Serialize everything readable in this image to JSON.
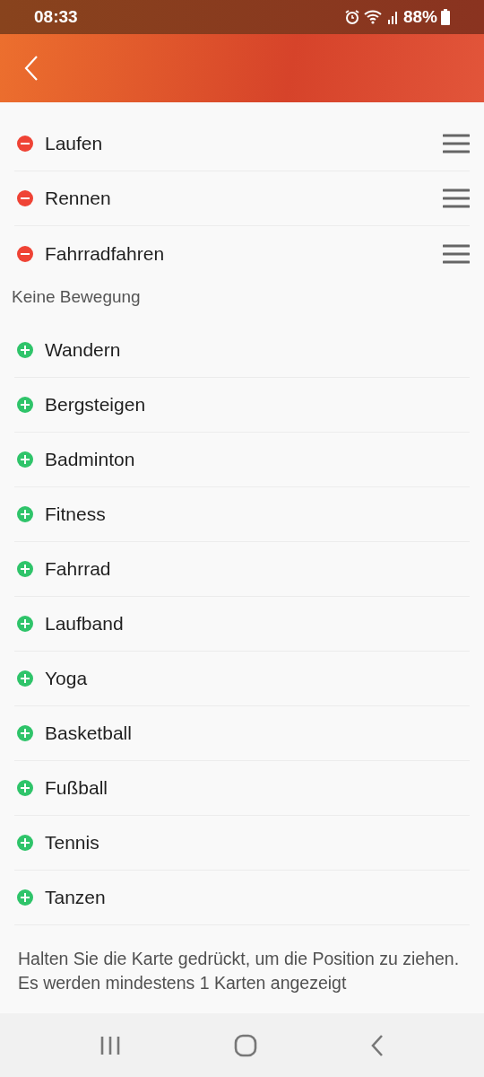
{
  "status_bar": {
    "time": "08:33",
    "battery": "88%"
  },
  "selected_sports": [
    {
      "name": "Laufen",
      "kind": "remove"
    },
    {
      "name": "Rennen",
      "kind": "remove"
    },
    {
      "name": "Fahrradfahren",
      "kind": "remove"
    }
  ],
  "section_title": "Keine Bewegung",
  "available_sports": [
    {
      "name": "Wandern",
      "kind": "add"
    },
    {
      "name": "Bergsteigen",
      "kind": "add"
    },
    {
      "name": "Badminton",
      "kind": "add"
    },
    {
      "name": "Fitness",
      "kind": "add"
    },
    {
      "name": "Fahrrad",
      "kind": "add"
    },
    {
      "name": "Laufband",
      "kind": "add"
    },
    {
      "name": "Yoga",
      "kind": "add"
    },
    {
      "name": "Basketball",
      "kind": "add"
    },
    {
      "name": "Fußball",
      "kind": "add"
    },
    {
      "name": "Tennis",
      "kind": "add"
    },
    {
      "name": "Tanzen",
      "kind": "add"
    }
  ],
  "hint": "Halten Sie die Karte gedrückt, um die Position zu ziehen. Es werden mindestens 1 Karten angezeigt"
}
